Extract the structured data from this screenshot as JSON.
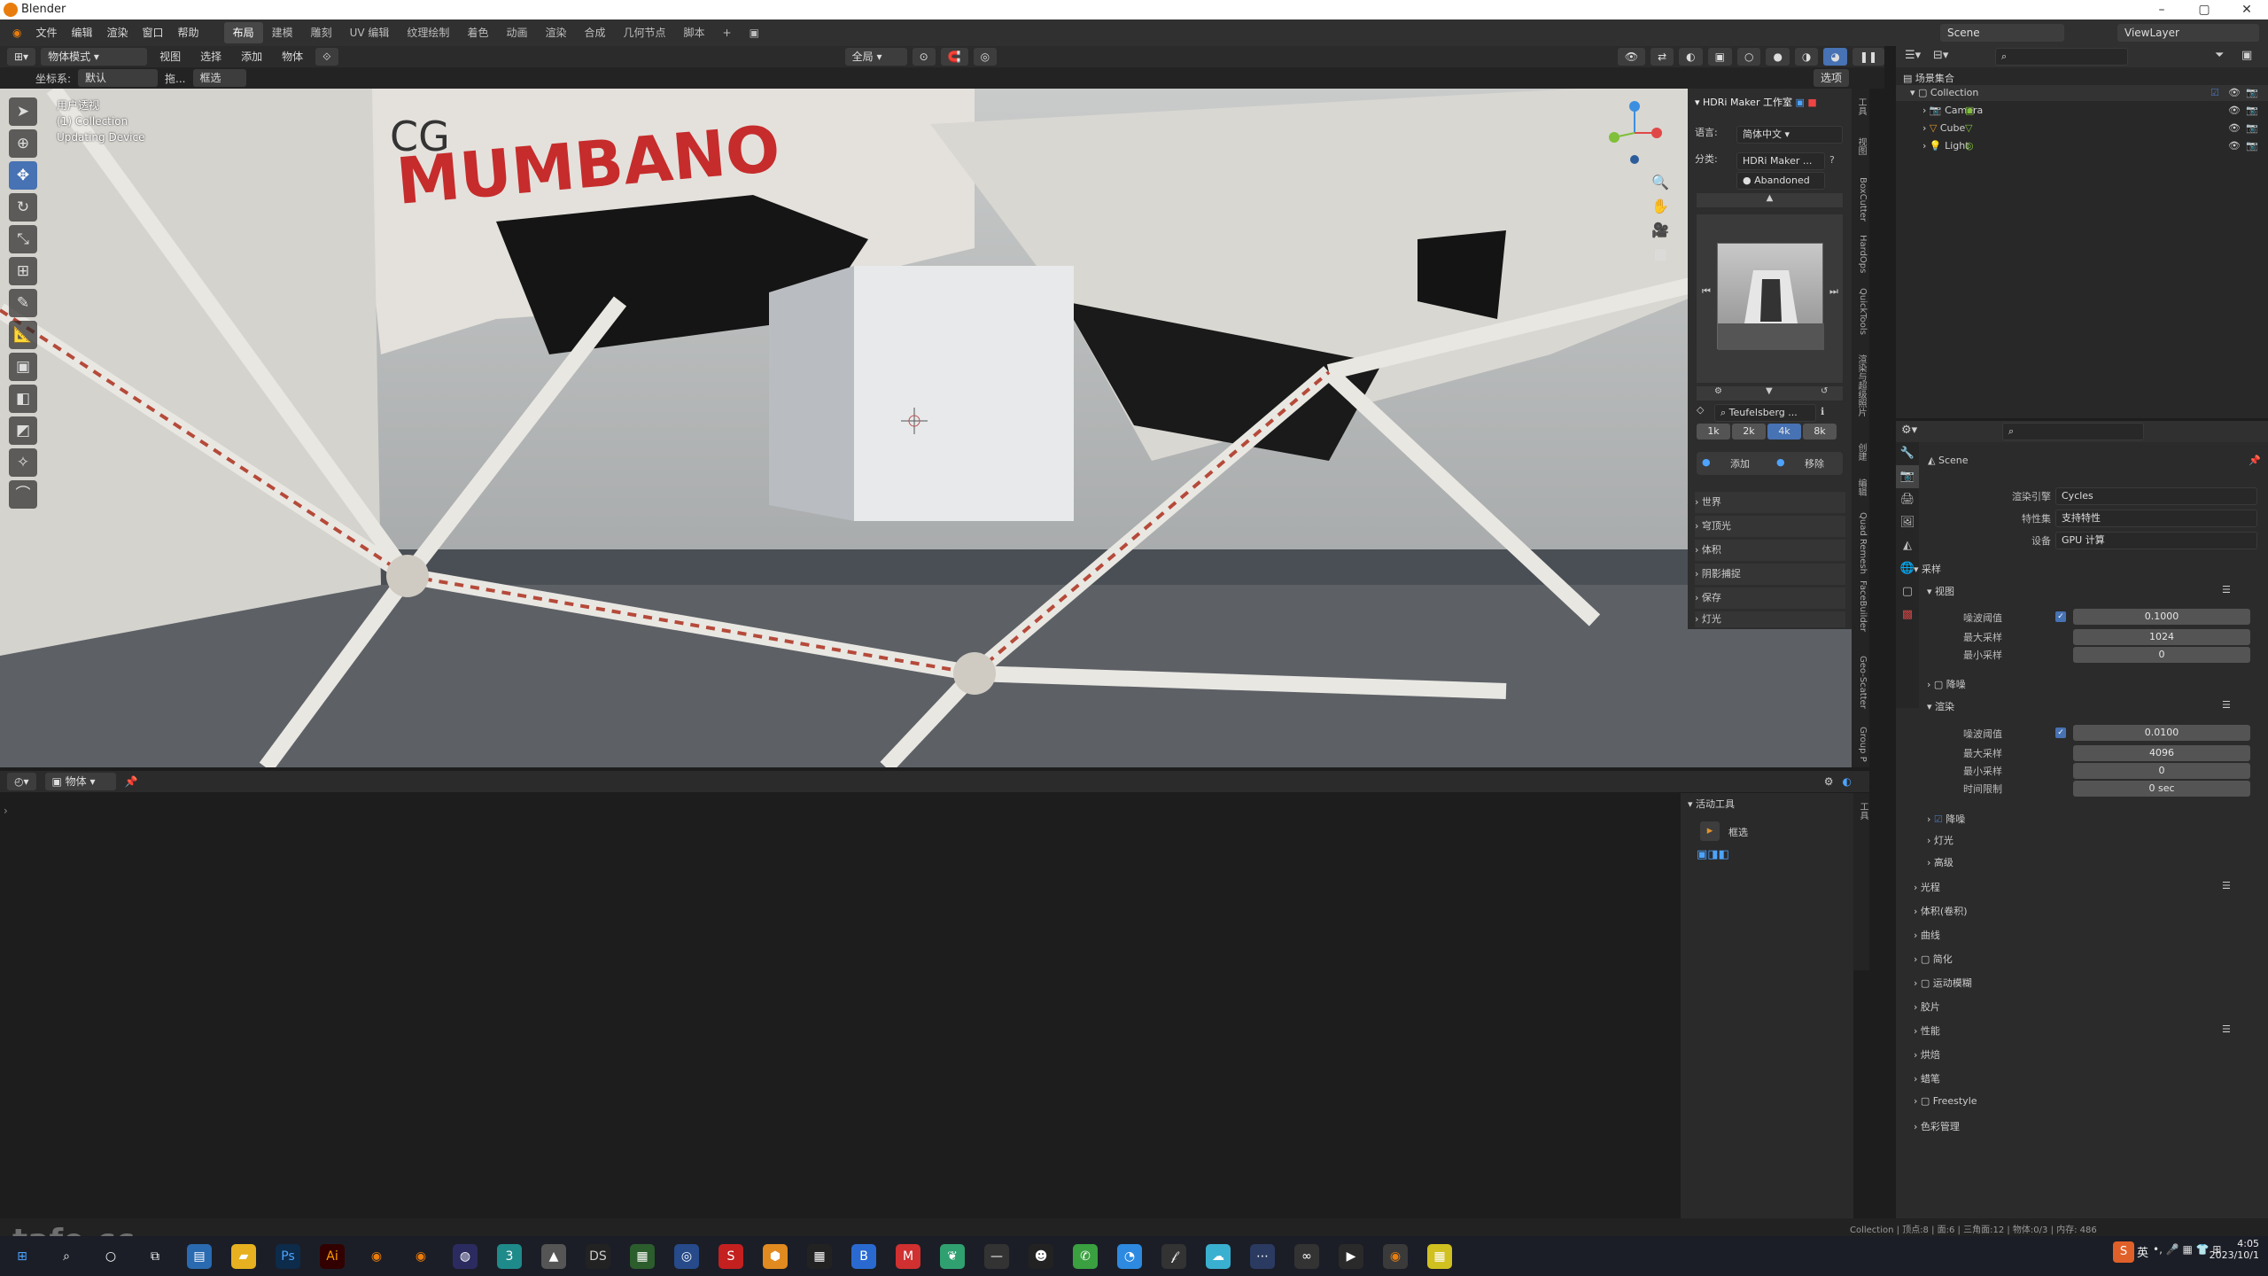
{
  "app": {
    "title": "Blender"
  },
  "menu": [
    "文件",
    "编辑",
    "渲染",
    "窗口",
    "帮助"
  ],
  "workspaces": [
    "布局",
    "建模",
    "雕刻",
    "UV 编辑",
    "纹理绘制",
    "着色",
    "动画",
    "渲染",
    "合成",
    "几何节点",
    "脚本"
  ],
  "scene": {
    "label": "Scene"
  },
  "view_layer": {
    "label": "ViewLayer"
  },
  "header": {
    "mode": "物体模式",
    "items": [
      "视图",
      "选择",
      "添加",
      "物体"
    ],
    "global": "全局",
    "options": "选项"
  },
  "header2": {
    "coord_label": "坐标系:",
    "coord_value": "默认",
    "drag": "拖...",
    "select": "框选"
  },
  "viewport": {
    "view_name": "用户透视",
    "collection": "(1) Collection",
    "status": "Updating Device"
  },
  "hdri": {
    "title": "HDRi Maker 工作室",
    "lang_label": "语言:",
    "lang_value": "简体中文",
    "cat_label": "分类:",
    "cat_value": "HDRi Maker ...",
    "sub_value": "Abandoned",
    "name": "Teufelsberg ...",
    "res": [
      "1k",
      "2k",
      "4k",
      "8k"
    ],
    "active_res": "4k",
    "add": "添加",
    "remove": "移除",
    "sections": [
      "世界",
      "穹顶光",
      "体积",
      "阴影捕捉",
      "保存",
      "灯光"
    ]
  },
  "vtabs": [
    "工具",
    "视图",
    "BoxCutter",
    "HardOps",
    "QuickTools",
    "渲染与超级照片",
    "创建",
    "编辑",
    "Quad Remesh",
    "FaceBuilder",
    "Geo-Scatter",
    "Group P"
  ],
  "outliner": {
    "root": "场景集合",
    "collection": "Collection",
    "items": [
      "Camera",
      "Cube",
      "Light"
    ]
  },
  "properties": {
    "scene": "Scene",
    "render_engine_label": "渲染引擎",
    "render_engine": "Cycles",
    "feature_set_label": "特性集",
    "feature_set": "支持特性",
    "device_label": "设备",
    "device": "GPU 计算",
    "sampling": "采样",
    "viewport": "视图",
    "noise_threshold_label": "噪波阈值",
    "vp_noise": "0.1000",
    "max_samples_label": "最大采样",
    "vp_max": "1024",
    "min_samples_label": "最小采样",
    "vp_min": "0",
    "denoise": "降噪",
    "render": "渲染",
    "r_noise": "0.0100",
    "r_max": "4096",
    "r_min": "0",
    "time_limit_label": "时间限制",
    "time_limit": "0 sec",
    "lights": "灯光",
    "advanced": "高级",
    "sections": [
      "光程",
      "体积(卷积)",
      "曲线",
      "简化",
      "运动模糊",
      "胶片",
      "性能",
      "烘焙",
      "蜡笔",
      "Freestyle",
      "色彩管理"
    ]
  },
  "timeline": {
    "mode": "物体"
  },
  "active_tool": {
    "title": "活动工具",
    "tool": "框选"
  },
  "status": {
    "text": "Collection | 顶点:8 | 面:6 | 三角面:12 | 物体:0/3 | 内存: 486"
  },
  "taskbar": {
    "time": "4:05",
    "date": "2023/10/1",
    "ime": "英"
  },
  "watermark": "tafe.cc"
}
